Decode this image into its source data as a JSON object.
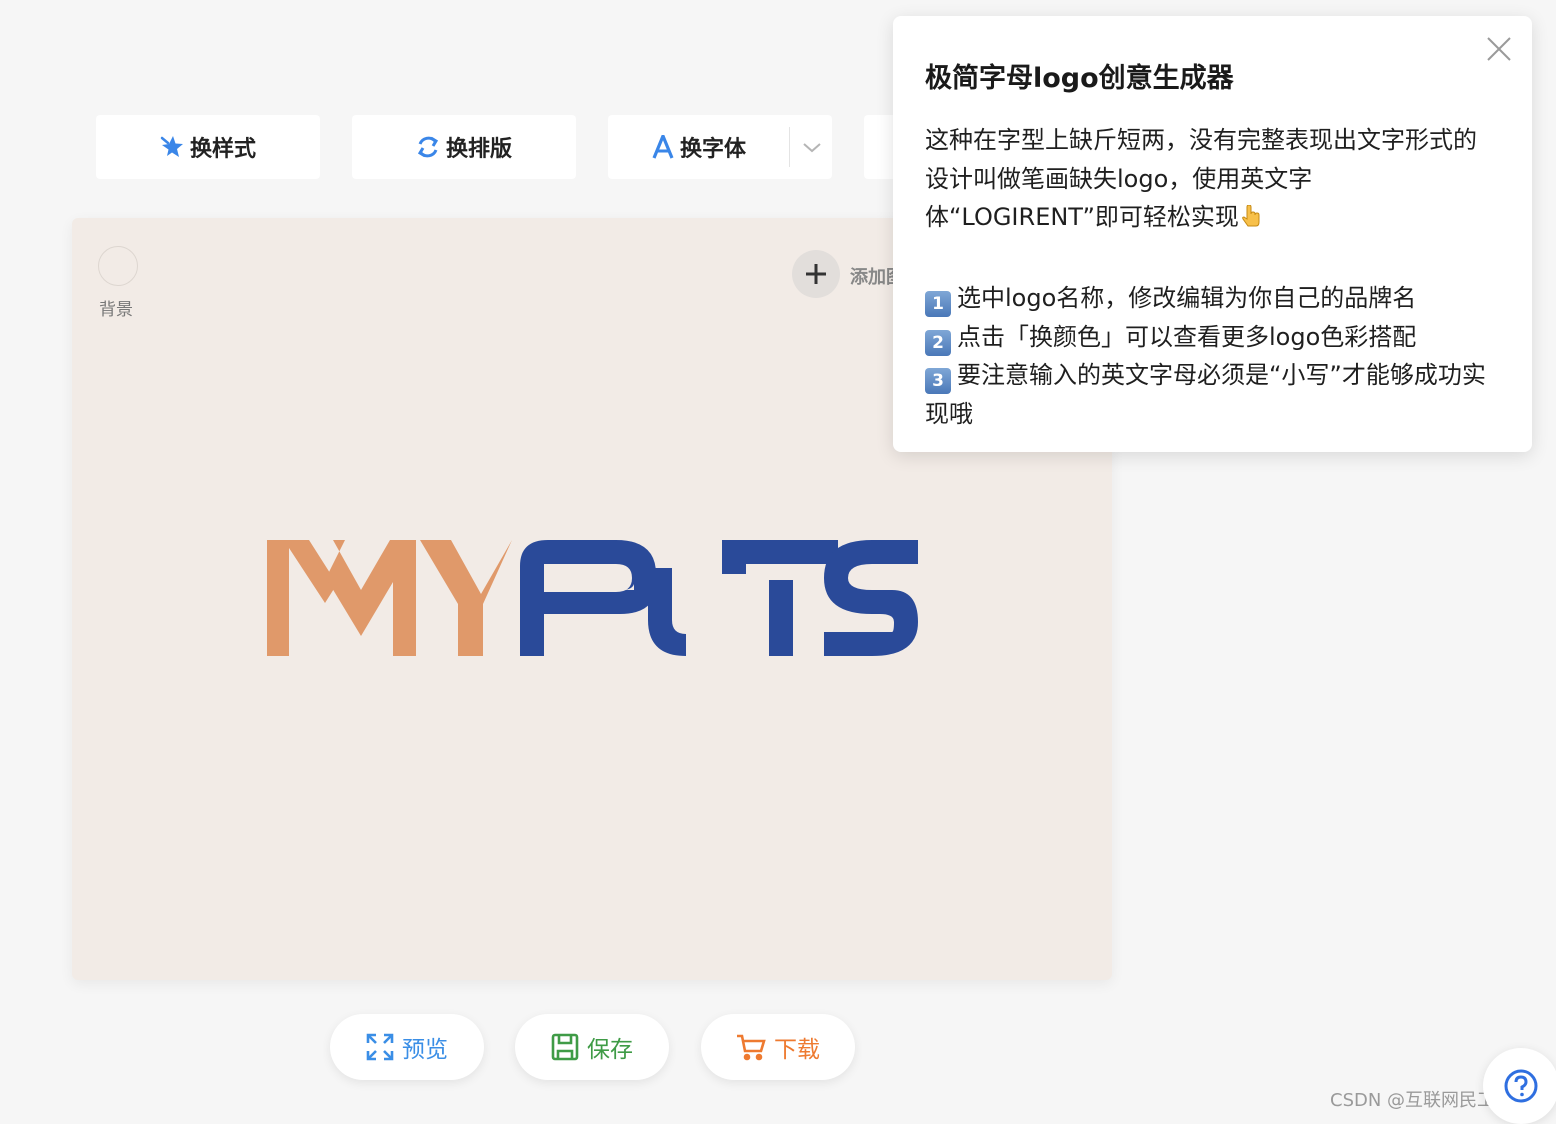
{
  "toolbar": {
    "style_label": "换样式",
    "layout_label": "换排版",
    "font_label": "换字体",
    "icons": {
      "style": "sparkle-icon",
      "layout": "refresh-icon",
      "font": "font-a-icon",
      "dropdown": "chevron-down-icon"
    }
  },
  "canvas": {
    "background_label": "背景",
    "background_color": "#f2ebe6",
    "add_label": "添加图",
    "logo": {
      "text_left": "MY",
      "text_right": "PUTS",
      "color_left": "#e0996a",
      "color_right": "#2a4a99"
    }
  },
  "actions": {
    "preview_label": "预览",
    "save_label": "保存",
    "download_label": "下载",
    "colors": {
      "preview": "#3a8ee6",
      "save": "#3f9b46",
      "download": "#ee7a30"
    }
  },
  "popover": {
    "title": "极简字母logo创意生成器",
    "intro": "这种在字型上缺斤短两，没有完整表现出文字形式的设计叫做笔画缺失logo，使用英文字体“LOGIRENT”即可轻松实现",
    "steps": [
      {
        "num": "1",
        "text": "选中logo名称，修改编辑为你自己的品牌名"
      },
      {
        "num": "2",
        "text": "点击「换颜色」可以查看更多logo色彩搭配"
      },
      {
        "num": "3",
        "text": "要注意输入的英文字母必须是“小写”才能够成功实现哦"
      }
    ]
  },
  "watermark": "CSDN @互联网民工阿强"
}
